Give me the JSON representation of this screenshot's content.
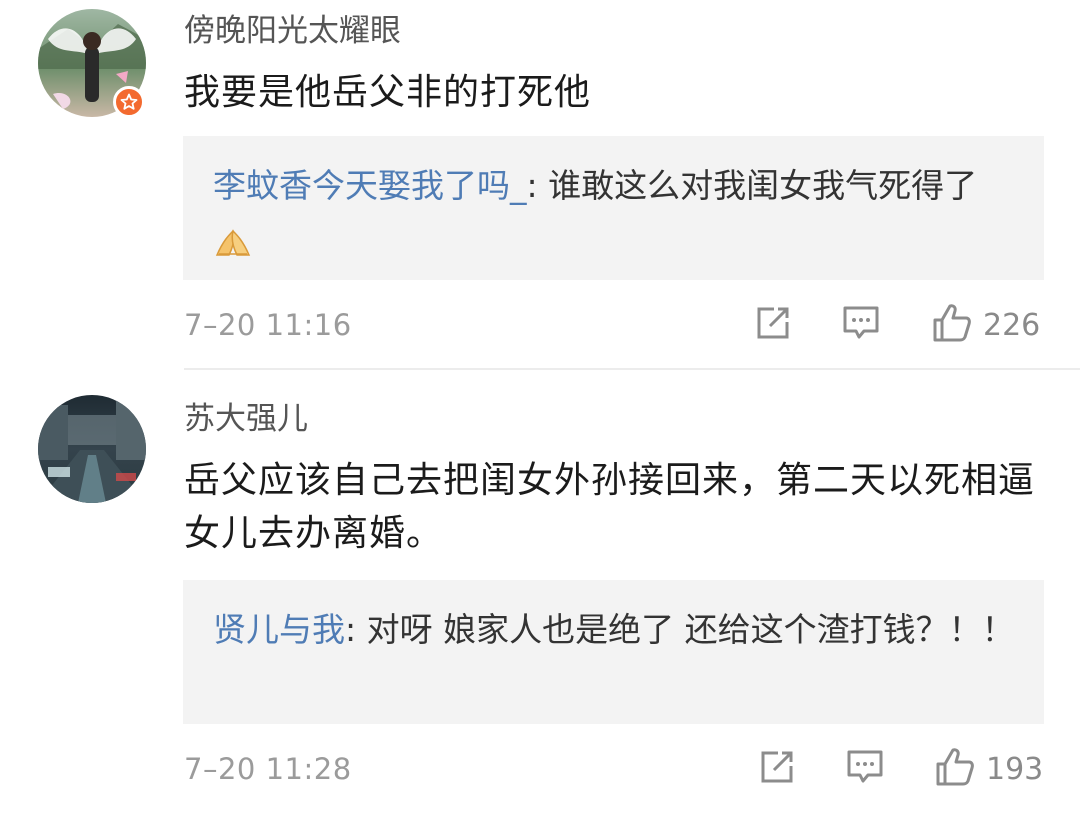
{
  "comments": [
    {
      "username": "傍晚阳光太耀眼",
      "text": "我要是他岳父非的打死他",
      "reply": {
        "user": "李蚊香今天娶我了吗_",
        "separator": ": ",
        "text": "谁敢这么对我闺女我气死得了"
      },
      "timestamp": "7–20 11:16",
      "likes": "226"
    },
    {
      "username": "苏大强儿",
      "text": "岳父应该自己去把闺女外孙接回来，第二天以死相逼女儿去办离婚。",
      "reply": {
        "user": "贤儿与我",
        "separator": ": ",
        "text": "对呀 娘家人也是绝了 还给这个渣打钱？！！"
      },
      "timestamp": "7–20 11:28",
      "likes": "193"
    }
  ],
  "icons": {
    "share": "share-icon",
    "comment": "comment-icon",
    "like": "thumbs-up-icon",
    "verified": "verified-badge-icon",
    "emoji": "praying-hands-emoji"
  },
  "colors": {
    "username": "#555555",
    "reply_user": "#4f7cb5",
    "reply_bg": "#f3f3f3",
    "meta": "#9b9b9b",
    "badge": "#f36a2f"
  }
}
